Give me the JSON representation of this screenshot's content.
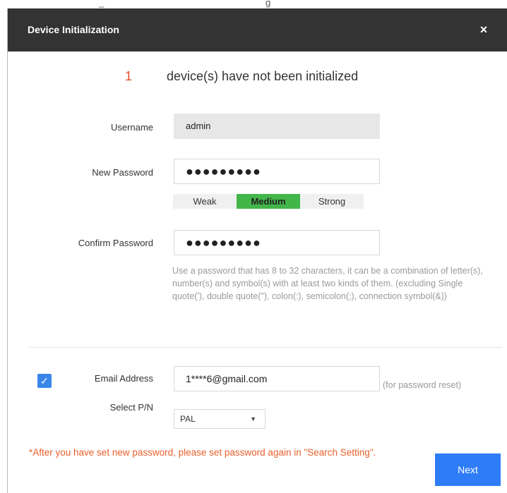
{
  "background_strip": {
    "fragment_left": "_",
    "fragment_right": "g"
  },
  "dialog": {
    "title": "Device Initialization",
    "close_symbol": "×",
    "status": {
      "count": "1",
      "text": "device(s) have not been initialized"
    },
    "fields": {
      "username": {
        "label": "Username",
        "value": "admin"
      },
      "new_password": {
        "label": "New Password",
        "value": "●●●●●●●●●"
      },
      "strength": {
        "weak": "Weak",
        "medium": "Medium",
        "strong": "Strong",
        "selected": "Medium"
      },
      "confirm_password": {
        "label": "Confirm Password",
        "value": "●●●●●●●●●"
      },
      "hint": "Use a password that has 8 to 32 characters, it can be a combination of letter(s), number(s) and symbol(s) with at least two kinds of them. (excluding Single quote('), double quote(\"), colon(:), semicolon(;), connection symbol(&))",
      "email": {
        "checked": true,
        "check_symbol": "✓",
        "label": "Email Address",
        "value": "1****6@gmail.com",
        "note": "(for password reset)"
      },
      "pn": {
        "label": "Select P/N",
        "value": "PAL",
        "caret": "▼"
      }
    },
    "warning": "*After you have set new password, please set password again in \"Search Setting\".",
    "next_label": "Next"
  },
  "colors": {
    "titlebar": "#333333",
    "accent": "#2e7cf6",
    "strength_medium": "#43b649",
    "warning": "#e8602c",
    "count": "#e8492c"
  }
}
